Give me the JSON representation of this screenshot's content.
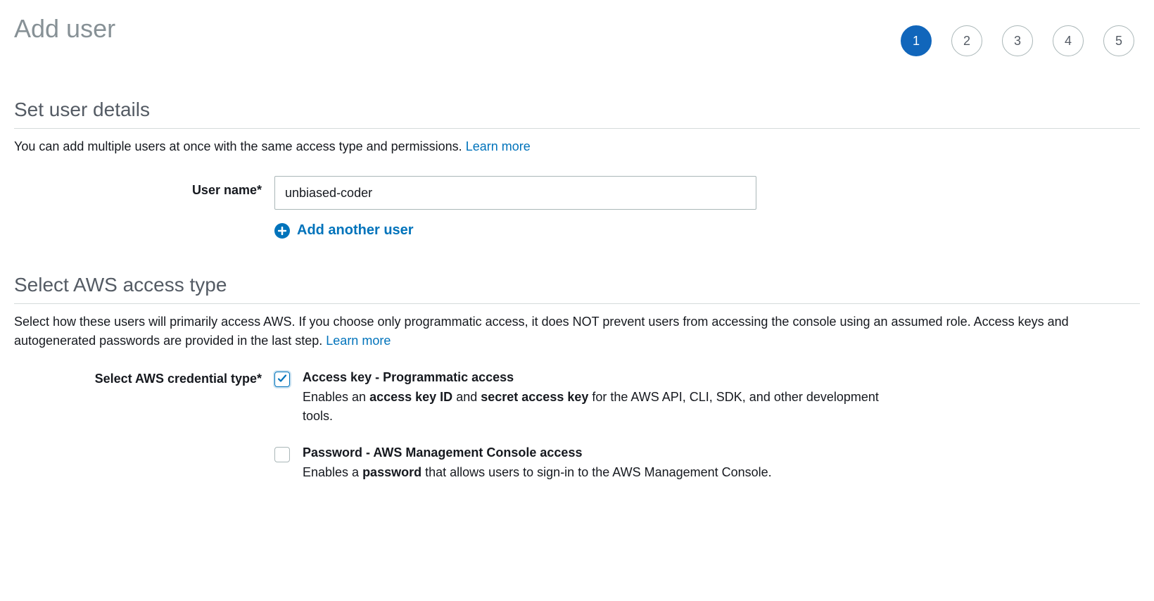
{
  "header": {
    "title": "Add user",
    "steps": [
      "1",
      "2",
      "3",
      "4",
      "5"
    ],
    "active_step": 0
  },
  "section_user_details": {
    "title": "Set user details",
    "description": "You can add multiple users at once with the same access type and permissions. ",
    "learn_more": "Learn more",
    "username_label": "User name*",
    "username_value": "unbiased-coder",
    "add_another_label": "Add another user"
  },
  "section_access_type": {
    "title": "Select AWS access type",
    "description": "Select how these users will primarily access AWS. If you choose only programmatic access, it does NOT prevent users from accessing the console using an assumed role. Access keys and autogenerated passwords are provided in the last step. ",
    "learn_more": "Learn more",
    "credential_label": "Select AWS credential type*",
    "options": [
      {
        "checked": true,
        "title": "Access key - Programmatic access",
        "desc_prefix": "Enables an ",
        "desc_bold1": "access key ID",
        "desc_mid": " and ",
        "desc_bold2": "secret access key",
        "desc_suffix": " for the AWS API, CLI, SDK, and other development tools."
      },
      {
        "checked": false,
        "title": "Password - AWS Management Console access",
        "desc_prefix": "Enables a ",
        "desc_bold1": "password",
        "desc_mid": "",
        "desc_bold2": "",
        "desc_suffix": " that allows users to sign-in to the AWS Management Console."
      }
    ]
  }
}
